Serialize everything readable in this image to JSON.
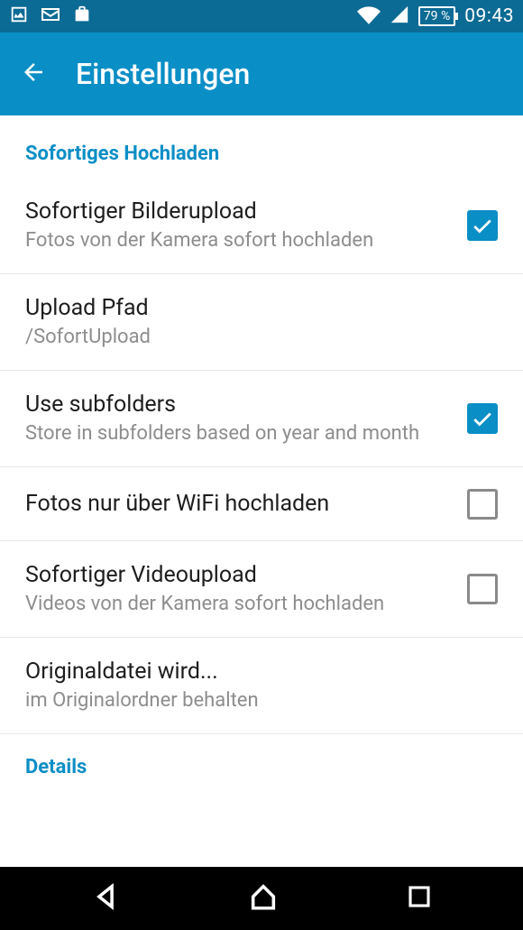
{
  "status": {
    "battery": "79 %",
    "time": "09:43"
  },
  "header": {
    "title": "Einstellungen"
  },
  "sections": {
    "upload_header": "Sofortiges Hochladen",
    "details_header": "Details"
  },
  "items": {
    "instant_photo": {
      "title": "Sofortiger Bilderupload",
      "subtitle": "Fotos von der Kamera sofort hochladen",
      "checked": true
    },
    "upload_path": {
      "title": "Upload Pfad",
      "subtitle": "/SofortUpload"
    },
    "subfolders": {
      "title": "Use subfolders",
      "subtitle": "Store in subfolders based on year and month",
      "checked": true
    },
    "wifi_only": {
      "title": "Fotos nur über WiFi hochladen",
      "checked": false
    },
    "instant_video": {
      "title": "Sofortiger Videoupload",
      "subtitle": "Videos von der Kamera sofort hochladen",
      "checked": false
    },
    "original_file": {
      "title": "Originaldatei wird...",
      "subtitle": "im Originalordner behalten"
    }
  }
}
